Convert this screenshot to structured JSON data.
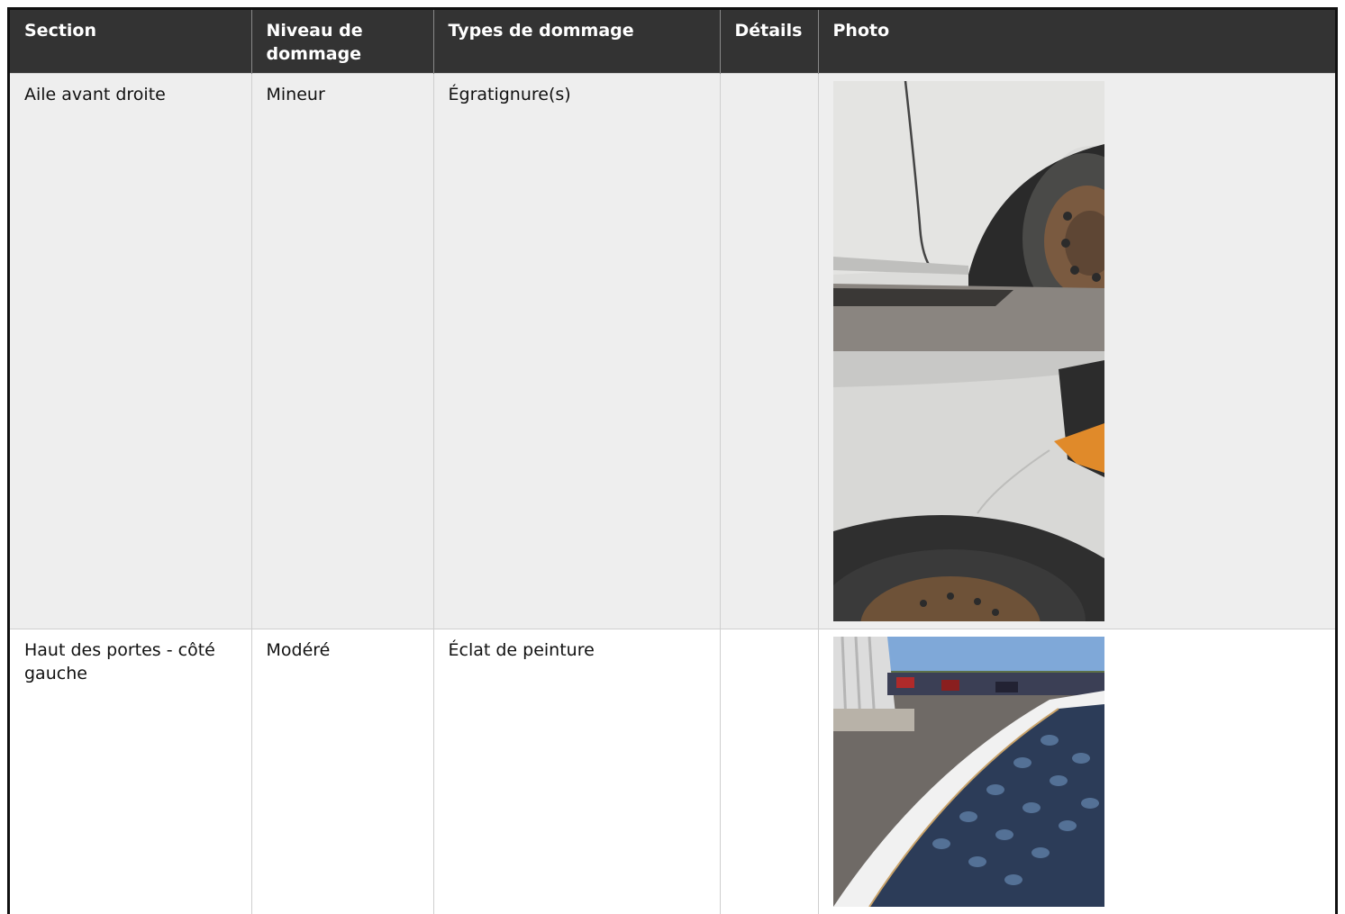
{
  "table": {
    "headers": {
      "section": "Section",
      "level": "Niveau de dommage",
      "types": "Types de dommage",
      "details": "Détails",
      "photo": "Photo"
    },
    "rows": [
      {
        "section": "Aile avant droite",
        "level": "Mineur",
        "types": "Égratignure(s)",
        "details": "",
        "photos": [
          "photo-front-right-wheel-arch",
          "photo-front-right-fender"
        ]
      },
      {
        "section": "Haut des portes - côté gauche",
        "level": "Modéré",
        "types": "Éclat de peinture",
        "details": "",
        "photos": [
          "photo-left-roof-edge"
        ]
      }
    ]
  },
  "colors": {
    "header_bg": "#333333",
    "row_odd_bg": "#eeeeee",
    "row_even_bg": "#ffffff"
  }
}
